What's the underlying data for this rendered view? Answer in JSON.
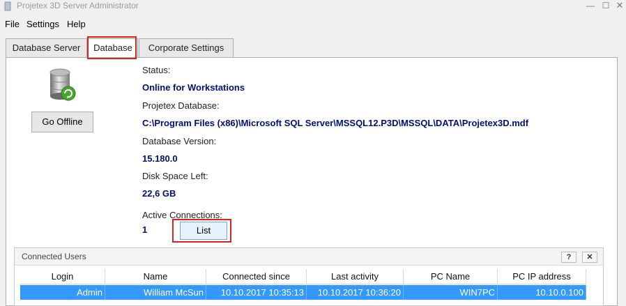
{
  "window": {
    "title": "Projetex 3D Server Administrator",
    "minimize": "—",
    "maximize": "☐",
    "close": "✕"
  },
  "menu": [
    {
      "label": "File"
    },
    {
      "label": "Settings"
    },
    {
      "label": "Help"
    }
  ],
  "tabs": [
    {
      "label": "Database Server",
      "active": false
    },
    {
      "label": "Database",
      "active": true
    },
    {
      "label": "Corporate Settings",
      "active": false
    }
  ],
  "left": {
    "go_offline_label": "Go Offline"
  },
  "info": {
    "status_label": "Status:",
    "status_value": "Online for Workstations",
    "database_label": "Projetex Database:",
    "database_value": "C:\\Program Files (x86)\\Microsoft SQL Server\\MSSQL12.P3D\\MSSQL\\DATA\\Projetex3D.mdf",
    "version_label": "Database Version:",
    "version_value": "15.180.0",
    "disk_label": "Disk Space Left:",
    "disk_value": "22,6 GB",
    "connections_label": "Active Connections:",
    "connections_value": "1",
    "list_label": "List"
  },
  "panel": {
    "title": "Connected Users",
    "help_label": "?",
    "close_label": "✕",
    "columns": [
      "Login",
      "Name",
      "Connected since",
      "Last activity",
      "PC Name",
      "PC IP address"
    ],
    "rows": [
      [
        "Admin",
        "William McSun",
        "10.10.2017 10:35:13",
        "10.10.2017 10:36:20",
        "WIN7PC",
        "10.10.0.100"
      ]
    ]
  },
  "colors": {
    "accent_text": "#000f7a",
    "highlight_box": "#d9251c",
    "selection": "#3399ff"
  }
}
